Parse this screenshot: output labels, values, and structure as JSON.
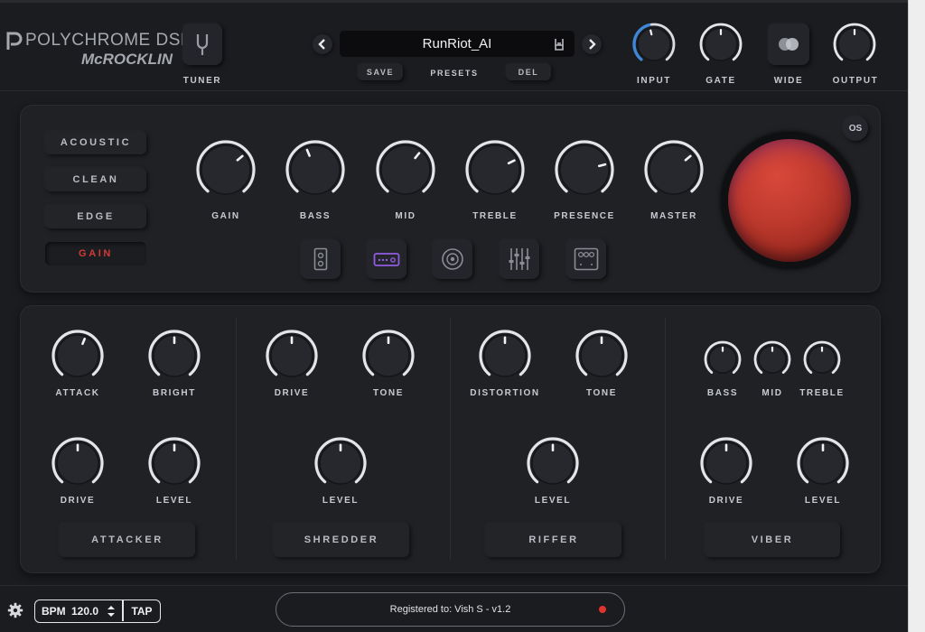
{
  "brand": {
    "name": "POLYCHROME DSP",
    "sub": "McROCKLIN"
  },
  "header": {
    "tuner": "TUNER",
    "preset_name": "RunRiot_AI",
    "save": "SAVE",
    "presets": "PRESETS",
    "del": "DEL",
    "knobs": [
      {
        "label": "INPUT",
        "value": 0.45,
        "accent": true
      },
      {
        "label": "GATE",
        "value": 0.5
      },
      {
        "label": "OUTPUT",
        "value": 0.5
      }
    ],
    "wide": "WIDE"
  },
  "amp": {
    "modes": [
      "ACOUSTIC",
      "CLEAN",
      "EDGE",
      "GAIN"
    ],
    "active_mode": "GAIN",
    "knobs": [
      {
        "label": "GAIN",
        "value": 0.68
      },
      {
        "label": "BASS",
        "value": 0.42
      },
      {
        "label": "MID",
        "value": 0.64
      },
      {
        "label": "TREBLE",
        "value": 0.73
      },
      {
        "label": "PRESENCE",
        "value": 0.77
      },
      {
        "label": "MASTER",
        "value": 0.68
      }
    ],
    "os": "OS",
    "tool_icons": [
      "speaker-cabinet-icon",
      "amp-head-icon",
      "speaker-cone-icon",
      "eq-sliders-icon",
      "pedal-icon"
    ]
  },
  "pedals": [
    {
      "name": "ATTACKER",
      "knobs": [
        {
          "label": "ATTACK",
          "value": 0.58
        },
        {
          "label": "BRIGHT",
          "value": 0.5
        },
        {
          "label": "DRIVE",
          "value": 0.5
        },
        {
          "label": "LEVEL",
          "value": 0.5
        }
      ]
    },
    {
      "name": "SHREDDER",
      "knobs": [
        {
          "label": "DRIVE",
          "value": 0.5
        },
        {
          "label": "TONE",
          "value": 0.5
        },
        {
          "label": "LEVEL",
          "value": 0.5
        }
      ]
    },
    {
      "name": "RIFFER",
      "knobs": [
        {
          "label": "DISTORTION",
          "value": 0.5
        },
        {
          "label": "TONE",
          "value": 0.5
        },
        {
          "label": "LEVEL",
          "value": 0.5
        }
      ]
    },
    {
      "name": "VIBER",
      "knobs": [
        {
          "label": "BASS",
          "value": 0.5
        },
        {
          "label": "MID",
          "value": 0.5
        },
        {
          "label": "TREBLE",
          "value": 0.5
        },
        {
          "label": "DRIVE",
          "value": 0.5
        },
        {
          "label": "LEVEL",
          "value": 0.5
        }
      ]
    }
  ],
  "footer": {
    "bpm_label": "BPM",
    "bpm_value": "120.0",
    "tap": "TAP",
    "registration": "Registered to: Vish S - v1.2"
  },
  "colors": {
    "accent_blue": "#3f86d6",
    "active_red": "#d23a36",
    "purple": "#8f5ce0",
    "status_dot": "#e0332e"
  }
}
